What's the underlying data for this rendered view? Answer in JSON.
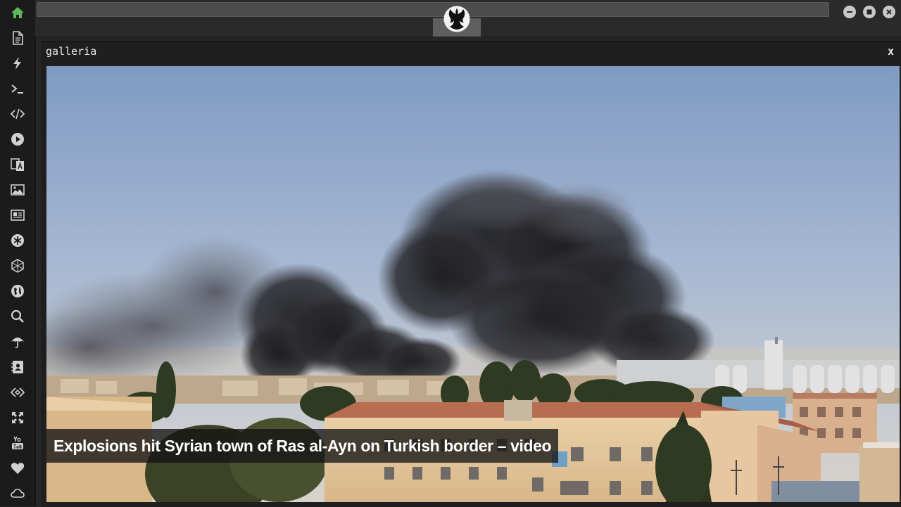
{
  "colors": {
    "accent_home": "#5cb85c",
    "sidebar_icon": "#d0d0d0",
    "sidebar_bg": "#1b1b1b"
  },
  "sidebar": {
    "items": [
      {
        "name": "home-icon"
      },
      {
        "name": "document-icon"
      },
      {
        "name": "lightning-icon"
      },
      {
        "name": "terminal-icon"
      },
      {
        "name": "code-icon"
      },
      {
        "name": "play-icon"
      },
      {
        "name": "translate-icon"
      },
      {
        "name": "image-icon"
      },
      {
        "name": "newspaper-icon"
      },
      {
        "name": "asterisk-icon"
      },
      {
        "name": "hexagon-icon"
      },
      {
        "name": "globe-icon"
      },
      {
        "name": "search-icon"
      },
      {
        "name": "umbrella-icon"
      },
      {
        "name": "contact-card-icon"
      },
      {
        "name": "link-code-icon"
      },
      {
        "name": "expand-icon"
      },
      {
        "name": "youtube-icon"
      },
      {
        "name": "heart-icon"
      },
      {
        "name": "cloud-icon"
      }
    ]
  },
  "topbar": {
    "logo": "rebel-alliance-logo",
    "window_buttons": [
      "minimize-icon",
      "maximize-icon",
      "close-icon"
    ]
  },
  "gallery": {
    "title": "galleria",
    "close_label": "x",
    "caption": "Explosions hit Syrian town of Ras al-Ayn on Turkish border – video"
  }
}
